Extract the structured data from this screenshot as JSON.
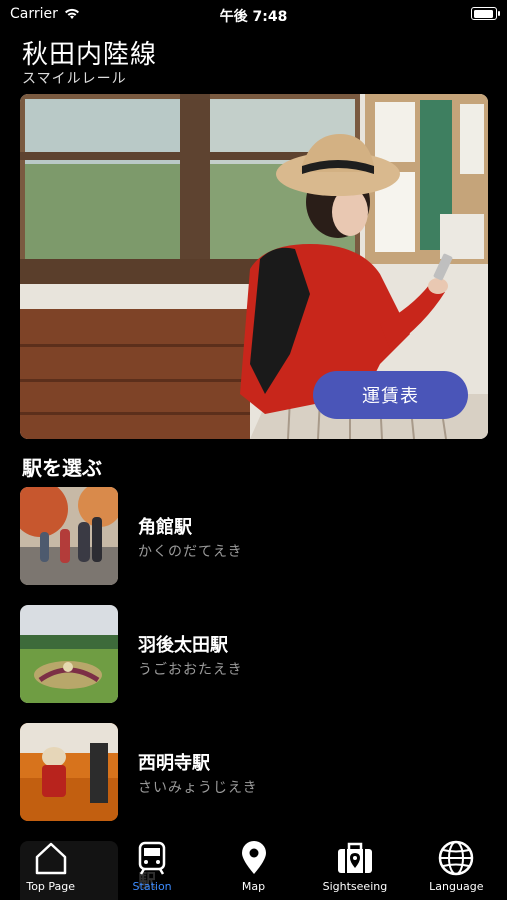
{
  "status_bar": {
    "carrier": "Carrier",
    "time": "午後 7:48"
  },
  "header": {
    "title": "秋田内陸線",
    "subtitle": "スマイルレール"
  },
  "hero": {
    "fare_button_label": "運賃表"
  },
  "section": {
    "title": "駅を選ぶ"
  },
  "stations": [
    {
      "name": "角館駅",
      "reading": "かくのだてえき"
    },
    {
      "name": "羽後太田駅",
      "reading": "うごおおたえき"
    },
    {
      "name": "西明寺駅",
      "reading": "さいみょうじえき"
    },
    {
      "name": "駅",
      "reading": ""
    }
  ],
  "tabs": [
    {
      "label": "Top Page",
      "icon": "home-icon"
    },
    {
      "label": "Station",
      "icon": "train-icon",
      "active": true
    },
    {
      "label": "Map",
      "icon": "map-pin-icon"
    },
    {
      "label": "Sightseeing",
      "icon": "suitcase-icon"
    },
    {
      "label": "Language",
      "icon": "globe-icon"
    }
  ],
  "colors": {
    "accent": "#3d8cff",
    "fare_button": "#4a55b8",
    "background": "#000000"
  }
}
